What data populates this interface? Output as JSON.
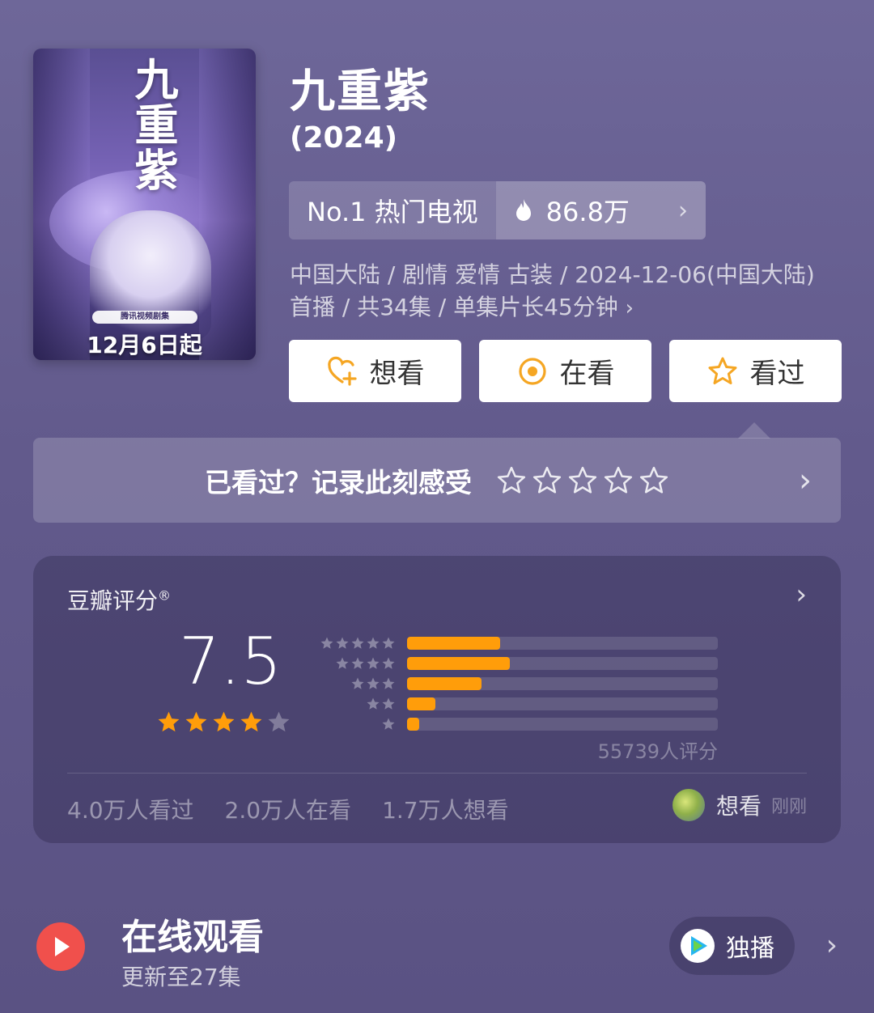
{
  "poster": {
    "title_art": "九重紫",
    "studio_badge": "腾讯视频剧集",
    "date_art": "12月6日起"
  },
  "header": {
    "title": "九重紫",
    "year": "(2024)"
  },
  "rank": {
    "label": "No.1 热门电视",
    "heat": "86.8万",
    "icon": "flame-icon"
  },
  "meta": {
    "line1": "中国大陆 / 剧情 爱情 古装 / 2024-12-06(中国大陆)",
    "line2": "首播 / 共34集 / 单集片长45分钟",
    "arrow": "›"
  },
  "actions": [
    {
      "label": "想看",
      "icon": "heart-plus-icon"
    },
    {
      "label": "在看",
      "icon": "target-icon"
    },
    {
      "label": "看过",
      "icon": "star-icon"
    }
  ],
  "record": {
    "text": "已看过？记录此刻感受",
    "stars": 5,
    "arrow": "›"
  },
  "douban": {
    "label": "豆瓣评分",
    "reg": "®",
    "arrow": "›",
    "score": "7.5",
    "stars_filled": 4,
    "rating_count": "55739人评分",
    "distribution": [
      {
        "stars": 5,
        "percent": 30
      },
      {
        "stars": 4,
        "percent": 33
      },
      {
        "stars": 3,
        "percent": 24
      },
      {
        "stars": 2,
        "percent": 9
      },
      {
        "stars": 1,
        "percent": 4
      }
    ],
    "stats": [
      "4.0万人看过",
      "2.0万人在看",
      "1.7万人想看"
    ],
    "activity": {
      "type": "想看",
      "time": "刚刚"
    }
  },
  "watch": {
    "title": "在线观看",
    "subtitle": "更新至27集",
    "badge": "独播",
    "arrow": "›"
  },
  "colors": {
    "accent_orange": "#ff9d0a",
    "play_red": "#f0504c",
    "tencent_blue": "#26b6ef"
  }
}
